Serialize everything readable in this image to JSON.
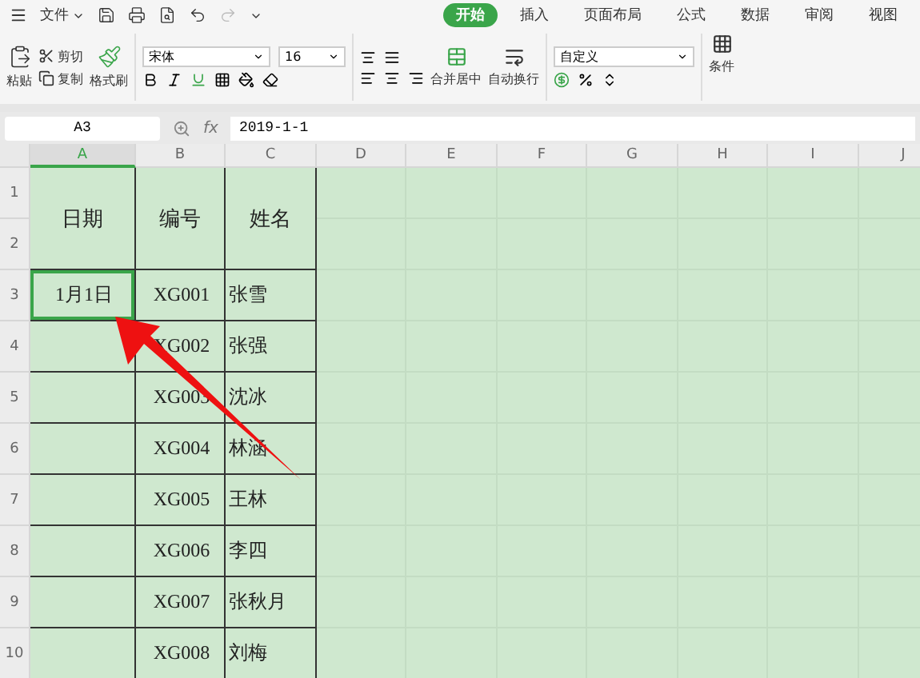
{
  "menu": {
    "file": "文件"
  },
  "tabs": [
    {
      "label": "开始",
      "selected": true
    },
    {
      "label": "插入",
      "selected": false
    },
    {
      "label": "页面布局",
      "selected": false
    },
    {
      "label": "公式",
      "selected": false
    },
    {
      "label": "数据",
      "selected": false
    },
    {
      "label": "审阅",
      "selected": false
    },
    {
      "label": "视图",
      "selected": false
    }
  ],
  "clipboard": {
    "paste": "粘贴",
    "cut": "剪切",
    "copy": "复制",
    "format_painter": "格式刷"
  },
  "font": {
    "name": "宋体",
    "size": "16"
  },
  "alignment": {
    "merge": "合并居中",
    "wrap": "自动换行"
  },
  "number_format": "自定义",
  "conditional": "条件",
  "name_box": "A3",
  "fx": "fx",
  "formula": "2019-1-1",
  "columns": [
    {
      "label": "A",
      "selected": true
    },
    {
      "label": "B",
      "selected": false
    },
    {
      "label": "C",
      "selected": false
    },
    {
      "label": "D",
      "selected": false
    },
    {
      "label": "E",
      "selected": false
    },
    {
      "label": "F",
      "selected": false
    },
    {
      "label": "G",
      "selected": false
    },
    {
      "label": "H",
      "selected": false
    },
    {
      "label": "I",
      "selected": false
    },
    {
      "label": "J",
      "selected": false
    }
  ],
  "row_headers": [
    "1",
    "2",
    "3",
    "4",
    "5",
    "6",
    "7",
    "8",
    "9",
    "10"
  ],
  "table": {
    "headers": [
      "日期",
      "编号",
      "姓名"
    ],
    "rows": [
      [
        {
          "text": "1月1日",
          "selected": true
        },
        {
          "text": "XG001",
          "selected": false
        },
        {
          "text": "张雪",
          "selected": false
        }
      ],
      [
        {
          "selected": false
        },
        {
          "text": "XG002",
          "selected": false
        },
        {
          "text": "张强",
          "selected": false
        }
      ],
      [
        {
          "selected": false
        },
        {
          "text": "XG003",
          "selected": false
        },
        {
          "text": "沈冰",
          "selected": false
        }
      ],
      [
        {
          "selected": false
        },
        {
          "text": "XG004",
          "selected": false
        },
        {
          "text": "林涵",
          "selected": false
        }
      ],
      [
        {
          "selected": false
        },
        {
          "text": "XG005",
          "selected": false
        },
        {
          "text": "王林",
          "selected": false
        }
      ],
      [
        {
          "selected": false
        },
        {
          "text": "XG006",
          "selected": false
        },
        {
          "text": "李四",
          "selected": false
        }
      ],
      [
        {
          "selected": false
        },
        {
          "text": "XG007",
          "selected": false
        },
        {
          "text": "张秋月",
          "selected": false
        }
      ],
      [
        {
          "selected": false
        },
        {
          "text": "XG008",
          "selected": false
        },
        {
          "text": "刘梅",
          "selected": false
        }
      ]
    ]
  }
}
